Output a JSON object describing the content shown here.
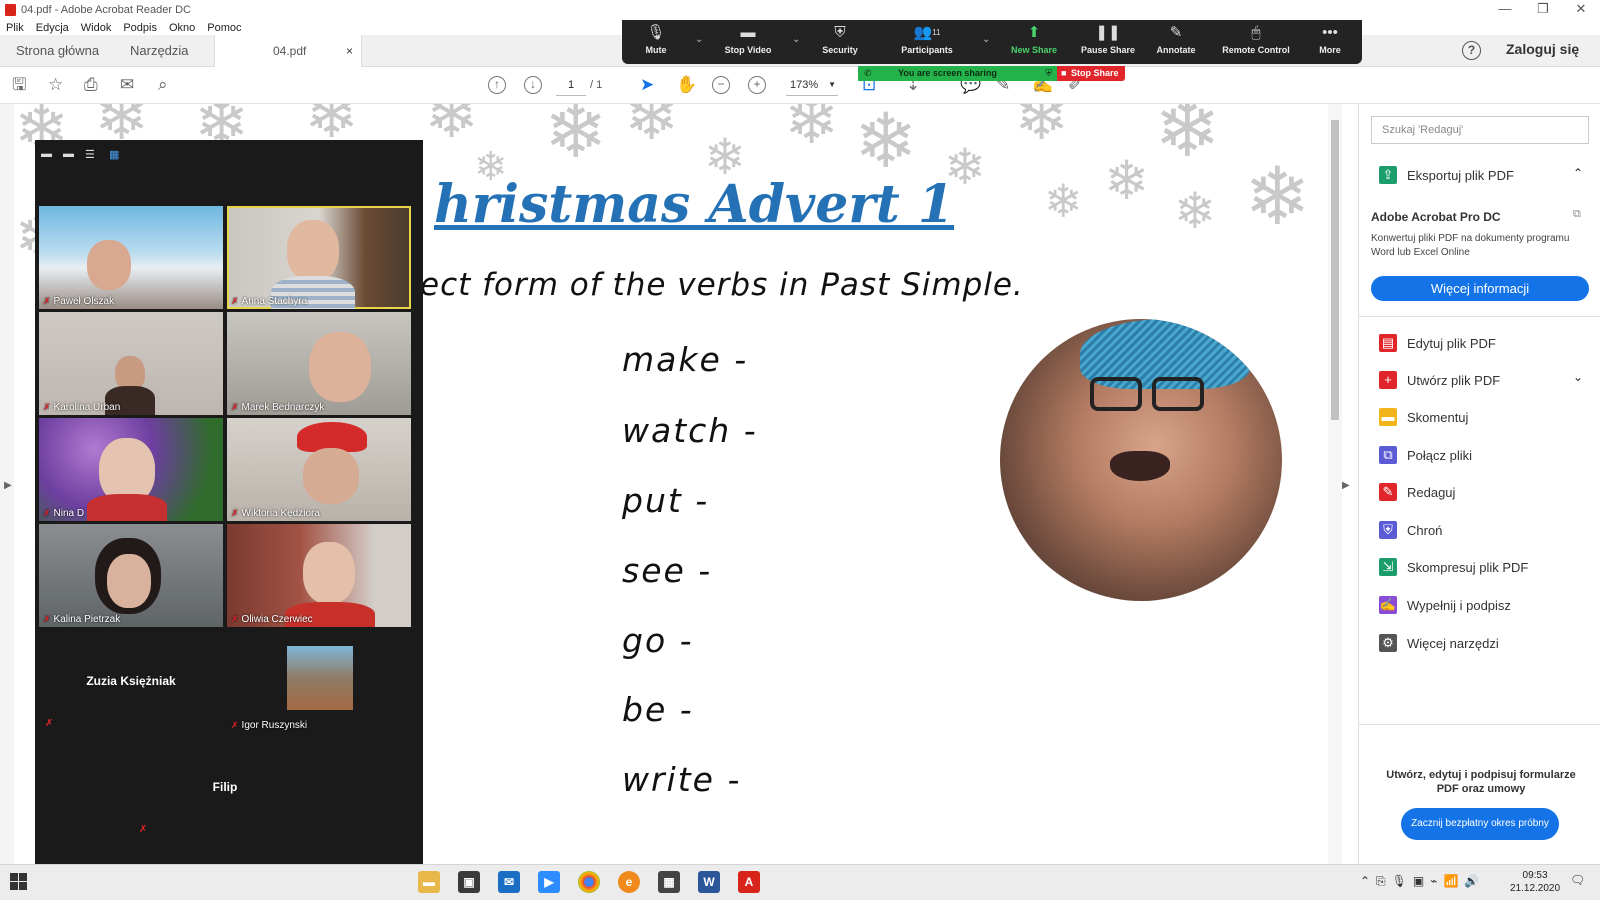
{
  "window": {
    "title": "04.pdf - Adobe Acrobat Reader DC",
    "controls": [
      "—",
      "❐",
      "✕"
    ]
  },
  "menu": [
    "Plik",
    "Edycja",
    "Widok",
    "Podpis",
    "Okno",
    "Pomoc"
  ],
  "tabs": {
    "home": "Strona główna",
    "tools": "Narzędzia",
    "file": "04.pdf",
    "close": "×"
  },
  "header": {
    "help": "?",
    "signin": "Zaloguj się"
  },
  "toolbar": {
    "page_current": "1",
    "page_total": "/ 1",
    "zoom": "173%"
  },
  "zoom_controls": {
    "mute": "Mute",
    "stop_video": "Stop Video",
    "security": "Security",
    "participants": "Participants",
    "participant_count": "11",
    "new_share": "New Share",
    "pause_share": "Pause Share",
    "annotate": "Annotate",
    "remote_control": "Remote Control",
    "more": "More",
    "sharing_status": "You are screen sharing",
    "stop_share": "Stop Share"
  },
  "document": {
    "title": "hristmas Advert 1",
    "instruction": "ect form of the verbs in Past Simple.",
    "verbs": [
      "make -",
      "watch -",
      "put -",
      "see -",
      "go -",
      "be -",
      "write -"
    ]
  },
  "gallery": {
    "participants": [
      {
        "name": "Paweł Olszak"
      },
      {
        "name": "Anna Stachyra"
      },
      {
        "name": "Karolina Urban"
      },
      {
        "name": "Marek Bednarczyk"
      },
      {
        "name": "Nina D"
      },
      {
        "name": "Wiktoria Kędziora"
      },
      {
        "name": "Kalina Pietrzak"
      },
      {
        "name": "Oliwia Czerwiec"
      },
      {
        "name": "Zuzia Księżniak"
      },
      {
        "name": "Igor Ruszynski"
      },
      {
        "name": "Filip"
      }
    ]
  },
  "right_panel": {
    "search_placeholder": "Szukaj 'Redaguj'",
    "export_pdf": "Eksportuj plik PDF",
    "promo_title": "Adobe Acrobat Pro DC",
    "promo_text": "Konwertuj pliki PDF na dokumenty programu Word lub Excel Online",
    "promo_button": "Więcej informacji",
    "tools": [
      {
        "label": "Edytuj plik PDF",
        "color": "#e0262b"
      },
      {
        "label": "Utwórz plik PDF",
        "color": "#e0262b"
      },
      {
        "label": "Skomentuj",
        "color": "#f1b51b"
      },
      {
        "label": "Połącz pliki",
        "color": "#5b5bd6"
      },
      {
        "label": "Redaguj",
        "color": "#e0262b"
      },
      {
        "label": "Chroń",
        "color": "#5b5bd6"
      },
      {
        "label": "Skompresuj plik PDF",
        "color": "#1b9e6b"
      },
      {
        "label": "Wypełnij i podpisz",
        "color": "#8a4cd6"
      },
      {
        "label": "Więcej narzędzi",
        "color": "#555555"
      }
    ],
    "bottom_text": "Utwórz, edytuj i podpisuj formularze PDF oraz umowy",
    "trial_button": "Zacznij bezpłatny okres próbny"
  },
  "taskbar": {
    "time": "09:53",
    "date": "21.12.2020"
  }
}
